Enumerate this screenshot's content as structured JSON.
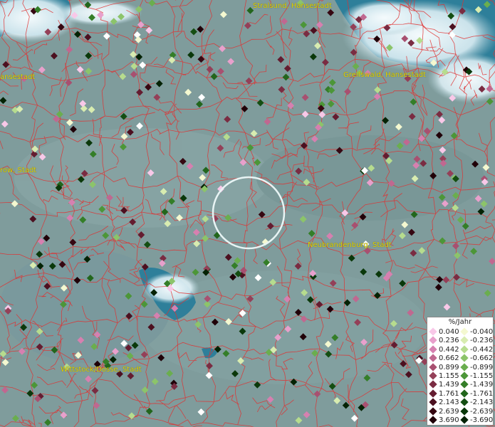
{
  "map": {
    "cities": [
      {
        "name": "Stralsund, Hansestadt"
      },
      {
        "name": "ansestadt"
      },
      {
        "name": "Greifswald, Hansestadt"
      },
      {
        "name": "row, Stadt"
      },
      {
        "name": "Neubrandenburg, Stadt"
      },
      {
        "name": "Wittstock/Dosse, Stadt"
      }
    ]
  },
  "legend": {
    "title": "%/Jahr",
    "positive": [
      {
        "label": "0.040",
        "color": "#f8c8e8"
      },
      {
        "label": "0.236",
        "color": "#e8a0cc"
      },
      {
        "label": "0.442",
        "color": "#d680b0"
      },
      {
        "label": "0.662",
        "color": "#c06890"
      },
      {
        "label": "0.899",
        "color": "#a85070"
      },
      {
        "label": "1.155",
        "color": "#944058"
      },
      {
        "label": "1.439",
        "color": "#7a2c42"
      },
      {
        "label": "1.761",
        "color": "#641c30"
      },
      {
        "label": "2.143",
        "color": "#4c1020"
      },
      {
        "label": "2.639",
        "color": "#360812"
      },
      {
        "label": "3.690",
        "color": "#200008"
      }
    ],
    "negative": [
      {
        "label": "-0.040",
        "color": "#f4f8d0"
      },
      {
        "label": "-0.236",
        "color": "#d8ecb0"
      },
      {
        "label": "-0.442",
        "color": "#b6dc8e"
      },
      {
        "label": "-0.662",
        "color": "#8cc46a"
      },
      {
        "label": "-0.899",
        "color": "#6aae4e"
      },
      {
        "label": "-1.155",
        "color": "#4c9638"
      },
      {
        "label": "-1.439",
        "color": "#347e28"
      },
      {
        "label": "-1.761",
        "color": "#22661c"
      },
      {
        "label": "-2.143",
        "color": "#144e12"
      },
      {
        "label": "-2.639",
        "color": "#0a380a"
      },
      {
        "label": "-3.690",
        "color": "#042204"
      }
    ]
  },
  "colors": {
    "boundary": "#e03030",
    "water": "#2e7f9a",
    "land": "#7f9c9c",
    "label": "#e6d600"
  }
}
